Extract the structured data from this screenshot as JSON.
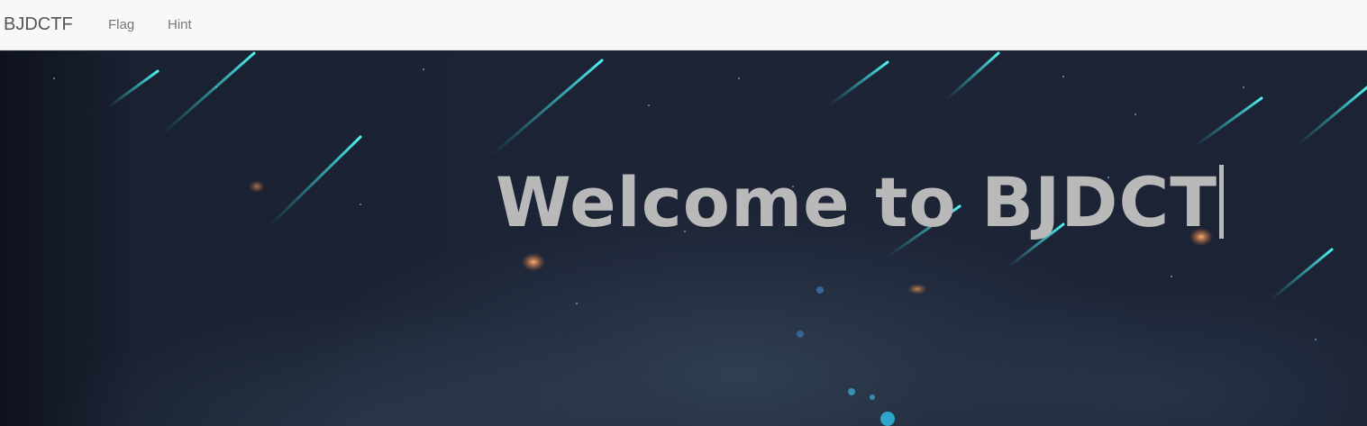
{
  "navbar": {
    "brand": "BJDCTF",
    "links": [
      {
        "label": "Flag"
      },
      {
        "label": "Hint"
      }
    ]
  },
  "hero": {
    "heading": "Welcome to BJDCT",
    "accent_color": "#2fd6d6",
    "text_color": "#b9b9b9"
  }
}
